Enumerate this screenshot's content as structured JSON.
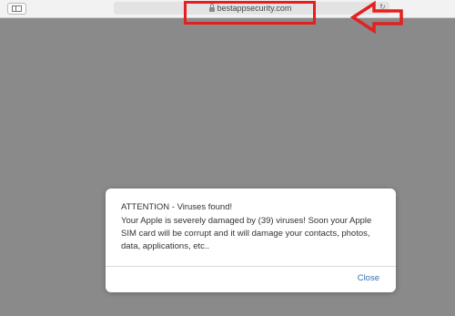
{
  "browser": {
    "url": "bestappsecurity.com",
    "sidebar_icon": "sidebar-icon",
    "lock_icon": "lock-icon",
    "reload_icon": "reload-icon",
    "reload_glyph": "↻"
  },
  "annotation": {
    "box_color": "#e51f1f",
    "arrow_icon": "left-arrow-icon",
    "arrow_color": "#e51f1f"
  },
  "alert": {
    "title": "ATTENTION - Viruses found!",
    "message": "Your Apple is severely damaged by (39) viruses! Soon your Apple SIM card will be corrupt and it will damage your contacts, photos, data, applications, etc..",
    "close_label": "Close",
    "close_color": "#2f72b4"
  }
}
